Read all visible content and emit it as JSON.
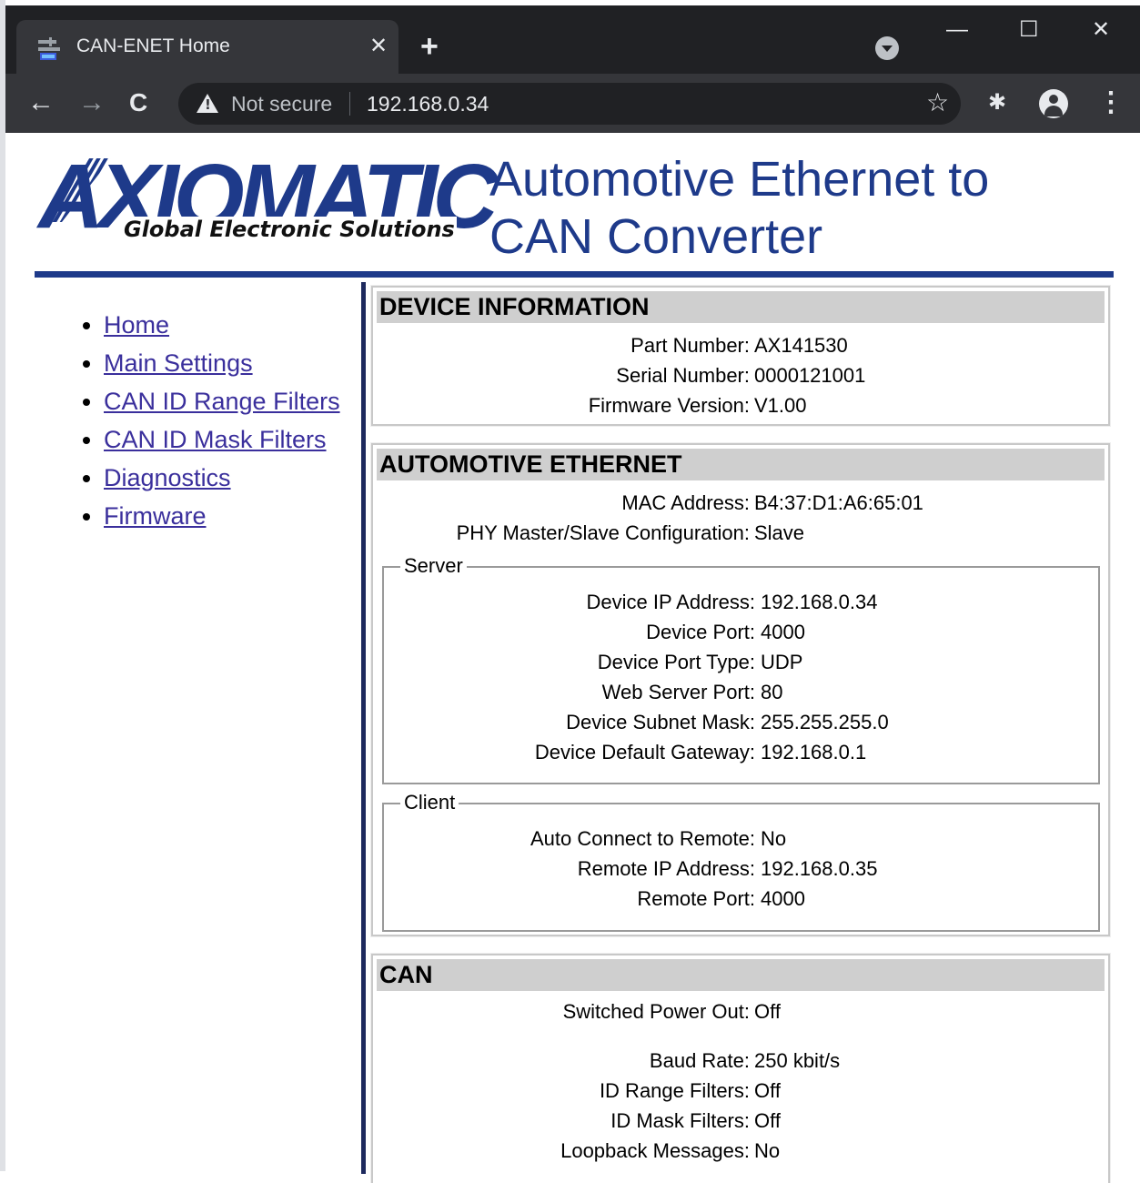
{
  "browser": {
    "tab_title": "CAN-ENET Home",
    "tab_close": "✕",
    "new_tab": "+",
    "window": {
      "minimize": "—",
      "maximize": "☐",
      "close": "✕"
    },
    "nav": {
      "back": "←",
      "forward": "→",
      "reload": "C"
    },
    "security_label": "Not secure",
    "url": "192.168.0.34",
    "bookmark_icon": "☆",
    "extensions_icon": "✱",
    "menu_icon": "⋮"
  },
  "header": {
    "logo_text": "AXIOMATIC",
    "logo_tagline": "Global Electronic Solutions",
    "title_line1": "Automotive Ethernet to",
    "title_line2": "CAN Converter"
  },
  "sidebar": {
    "items": [
      {
        "label": "Home"
      },
      {
        "label": "Main Settings"
      },
      {
        "label": "CAN ID Range Filters"
      },
      {
        "label": "CAN ID Mask Filters"
      },
      {
        "label": "Diagnostics"
      },
      {
        "label": "Firmware"
      }
    ]
  },
  "device_information": {
    "title": "DEVICE INFORMATION",
    "rows": [
      {
        "label": "Part Number:",
        "value": "AX141530"
      },
      {
        "label": "Serial Number:",
        "value": "0000121001"
      },
      {
        "label": "Firmware Version:",
        "value": "V1.00"
      }
    ]
  },
  "automotive_ethernet": {
    "title": "AUTOMOTIVE ETHERNET",
    "rows": [
      {
        "label": "MAC Address:",
        "value": "B4:37:D1:A6:65:01"
      },
      {
        "label": "PHY Master/Slave Configuration:",
        "value": "Slave"
      }
    ],
    "server": {
      "legend": "Server",
      "rows": [
        {
          "label": "Device IP Address:",
          "value": "192.168.0.34"
        },
        {
          "label": "Device Port:",
          "value": "4000"
        },
        {
          "label": "Device Port Type:",
          "value": "UDP"
        },
        {
          "label": "Web Server Port:",
          "value": "80"
        },
        {
          "label": "Device Subnet Mask:",
          "value": "255.255.255.0"
        },
        {
          "label": "Device Default Gateway:",
          "value": "192.168.0.1"
        }
      ]
    },
    "client": {
      "legend": "Client",
      "rows": [
        {
          "label": "Auto Connect to Remote:",
          "value": "No"
        },
        {
          "label": "Remote IP Address:",
          "value": "192.168.0.35"
        },
        {
          "label": "Remote Port:",
          "value": "4000"
        }
      ]
    }
  },
  "can": {
    "title": "CAN",
    "rows": [
      {
        "label": "Switched Power Out:",
        "value": "Off"
      },
      {
        "label": "Baud Rate:",
        "value": "250 kbit/s"
      },
      {
        "label": "ID Range Filters:",
        "value": "Off"
      },
      {
        "label": "ID Mask Filters:",
        "value": "Off"
      },
      {
        "label": "Loopback Messages:",
        "value": "No"
      }
    ]
  },
  "colors": {
    "brand_blue": "#1e3a8a",
    "link": "#3a2f9c",
    "section_header": "#cfcfcf",
    "chrome_dark": "#202124"
  }
}
